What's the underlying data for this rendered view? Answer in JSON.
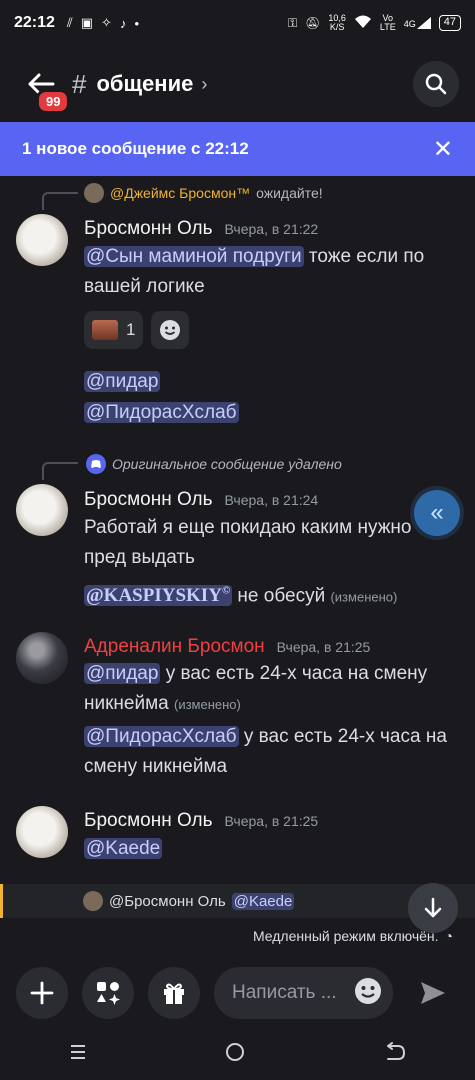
{
  "status_bar": {
    "time": "22:12",
    "net_speed_value": "10,6",
    "net_speed_unit": "K/S",
    "volte_top": "Vo",
    "volte_bottom": "LTE",
    "network": "4G",
    "battery": "47"
  },
  "header": {
    "unread_badge": "99",
    "hash": "#",
    "channel_name": "общение",
    "chevron": "›"
  },
  "new_messages_bar": {
    "text": "1 новое сообщение с 22:12",
    "close": "✕"
  },
  "messages": [
    {
      "reply_to": {
        "author": "@Джеймс Бросмон™",
        "text": "ожидайте!"
      },
      "author": "Бросмонн Оль",
      "timestamp": "Вчера, в 21:22",
      "mention1": "@Сын маминой подруги",
      "text1": " тоже если по вашей логике",
      "reaction_count": "1",
      "mention2": "@пидар",
      "mention3": "@ПидорасХслаб"
    },
    {
      "reply_to": {
        "text": "Оригинальное сообщение удалено"
      },
      "author": "Бросмонн Оль",
      "timestamp": "Вчера, в 21:24",
      "text1": "Работай я еще покидаю каким нужно пред выдать",
      "mention1": "@KASPIYSKIY",
      "mention1_suffix": "©",
      "text2": " не обесуй ",
      "edited": "(изменено)"
    },
    {
      "author": "Адреналин Бросмон",
      "author_color": "#f23f43",
      "timestamp": "Вчера, в 21:25",
      "mention1": "@пидар",
      "text1": " у вас есть 24-х часа на смену никнейма ",
      "edited": "(изменено)",
      "mention2": "@ПидорасХслаб",
      "text2": " у вас есть 24-х часа на смену никнейма"
    },
    {
      "author": "Бросмонн Оль",
      "timestamp": "Вчера, в 21:25",
      "mention1": "@Kaede"
    }
  ],
  "reply_strip": {
    "author": "@Бросмонн Оль",
    "mention": "@Kaede"
  },
  "slow_mode": "Медленный режим включён.",
  "composer": {
    "placeholder": "Написать ..."
  },
  "accent": "#5865f2"
}
